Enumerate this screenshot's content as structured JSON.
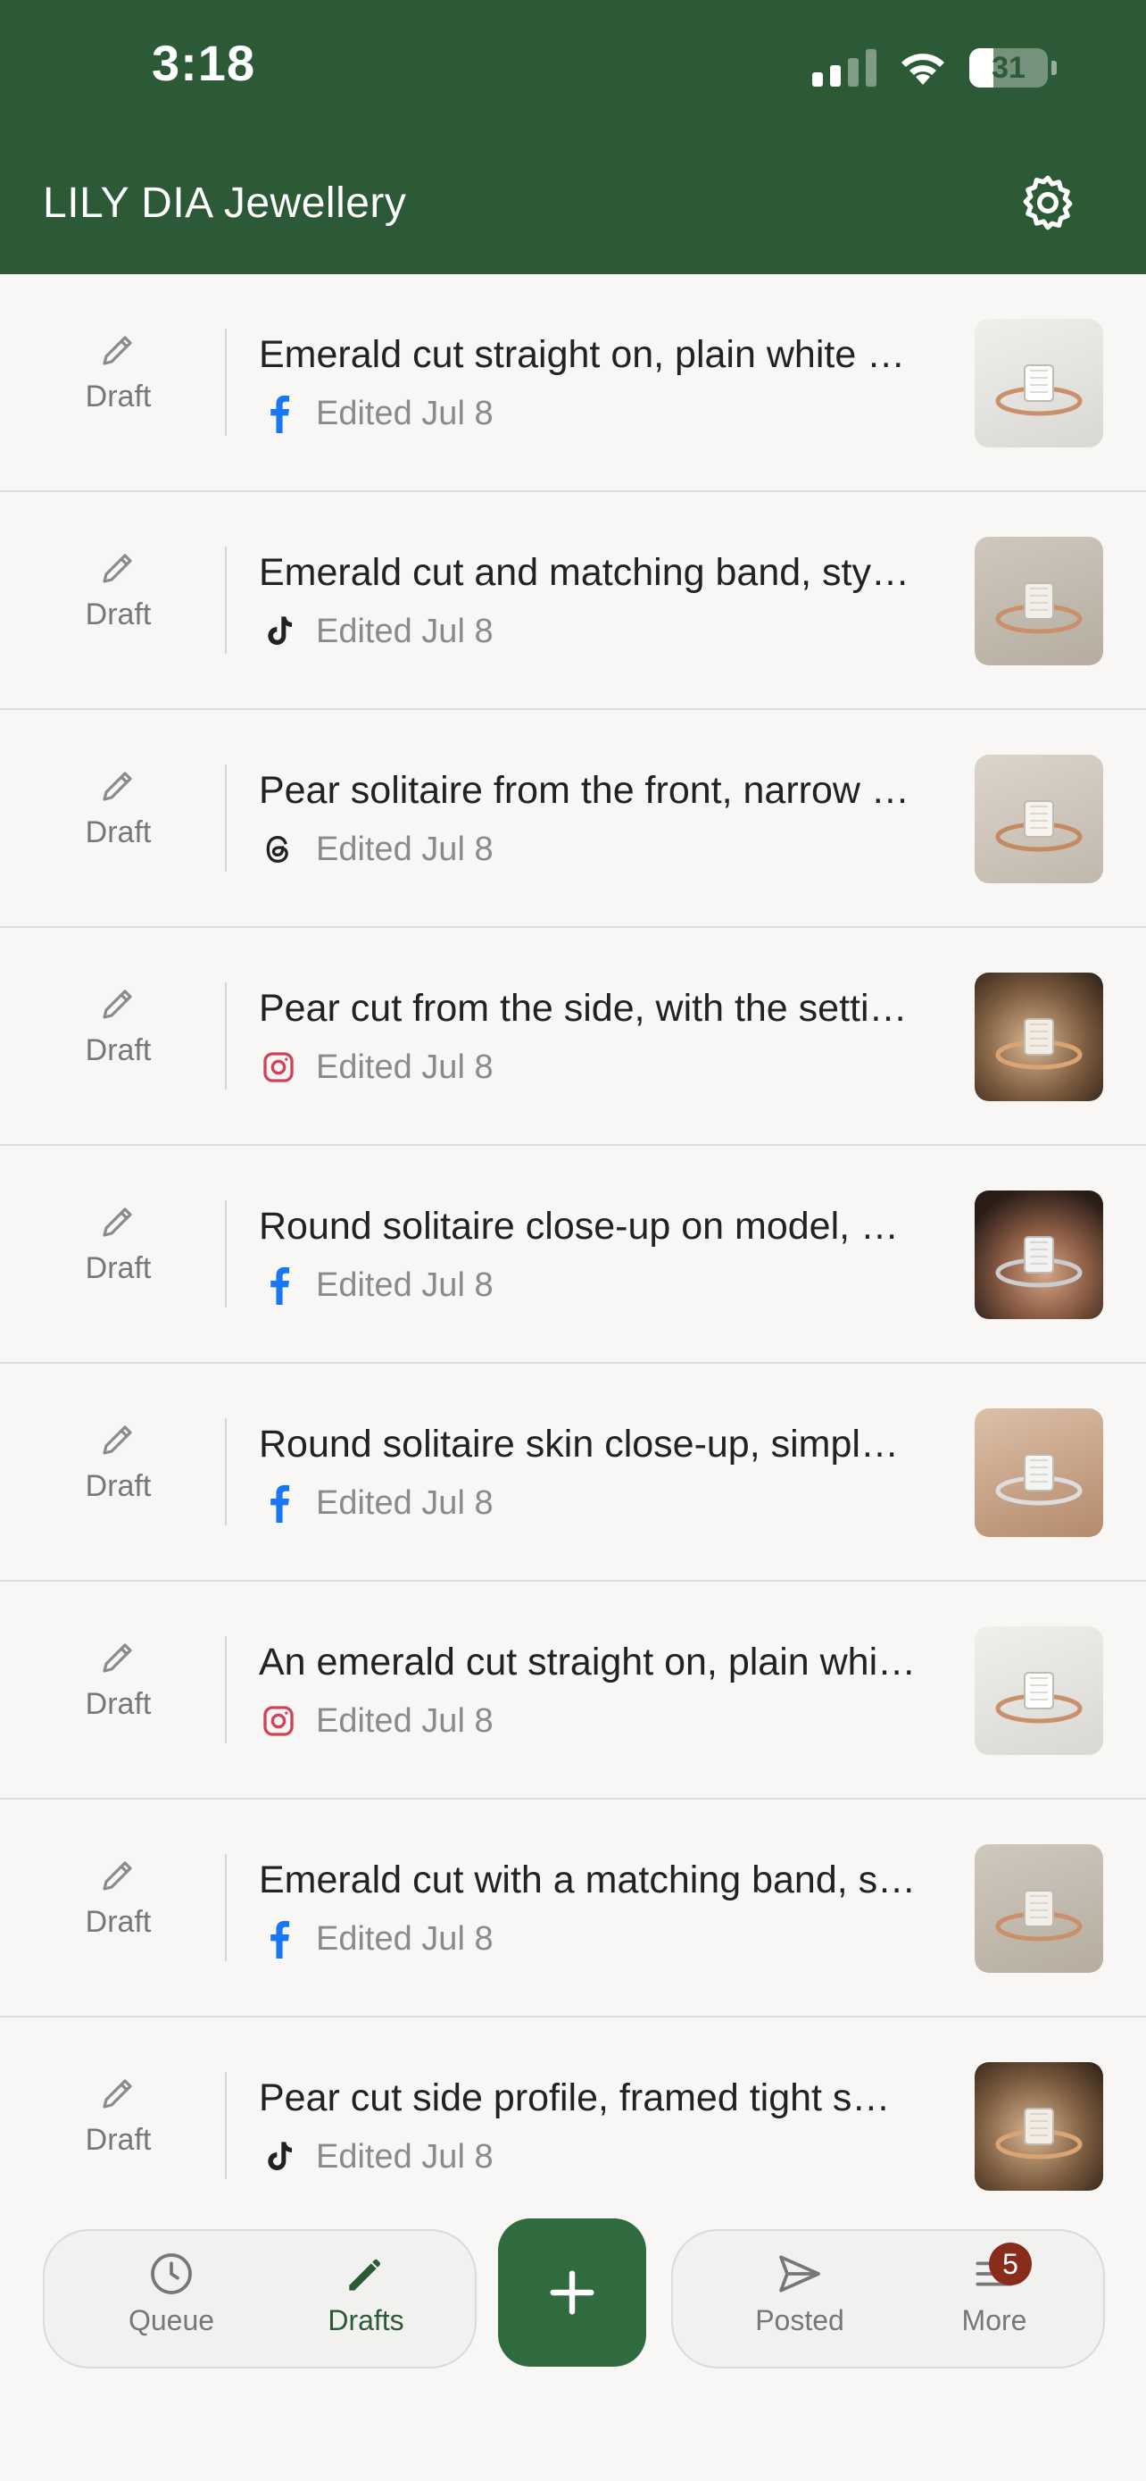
{
  "status_bar": {
    "time": "3:18",
    "battery_level": "31",
    "battery_fraction": 0.31
  },
  "header": {
    "title": "LILY DIA Jewellery",
    "settings_icon": "gear-icon"
  },
  "theme": {
    "header_bg": "#2c5a36",
    "fab_bg": "#2f6b3f",
    "badge_bg": "#8a2c1c"
  },
  "drafts": [
    {
      "status": "Draft",
      "title": "Emerald cut straight on, plain white …",
      "network": "facebook",
      "edited": "Edited Jul 8",
      "thumb": "emerald-white"
    },
    {
      "status": "Draft",
      "title": "Emerald cut and matching band, sty…",
      "network": "tiktok",
      "edited": "Edited Jul 8",
      "thumb": "emerald-band"
    },
    {
      "status": "Draft",
      "title": "Pear solitaire from the front, narrow …",
      "network": "threads",
      "edited": "Edited Jul 8",
      "thumb": "pear-front"
    },
    {
      "status": "Draft",
      "title": "Pear cut from the side, with the setti…",
      "network": "instagram",
      "edited": "Edited Jul 8",
      "thumb": "pear-side"
    },
    {
      "status": "Draft",
      "title": "Round solitaire close-up on model, …",
      "network": "facebook",
      "edited": "Edited Jul 8",
      "thumb": "round-model"
    },
    {
      "status": "Draft",
      "title": "Round solitaire skin close-up, simpl…",
      "network": "facebook",
      "edited": "Edited Jul 8",
      "thumb": "round-hand"
    },
    {
      "status": "Draft",
      "title": "An emerald cut straight on, plain whi…",
      "network": "instagram",
      "edited": "Edited Jul 8",
      "thumb": "emerald-white"
    },
    {
      "status": "Draft",
      "title": "Emerald cut with a matching band, s…",
      "network": "facebook",
      "edited": "Edited Jul 8",
      "thumb": "emerald-band"
    },
    {
      "status": "Draft",
      "title": "Pear cut side profile, framed tight s…",
      "network": "tiktok",
      "edited": "Edited Jul 8",
      "thumb": "pear-side"
    }
  ],
  "bottom_nav": {
    "queue": "Queue",
    "drafts": "Drafts",
    "posted": "Posted",
    "more": "More",
    "more_badge": "5",
    "active": "drafts"
  }
}
